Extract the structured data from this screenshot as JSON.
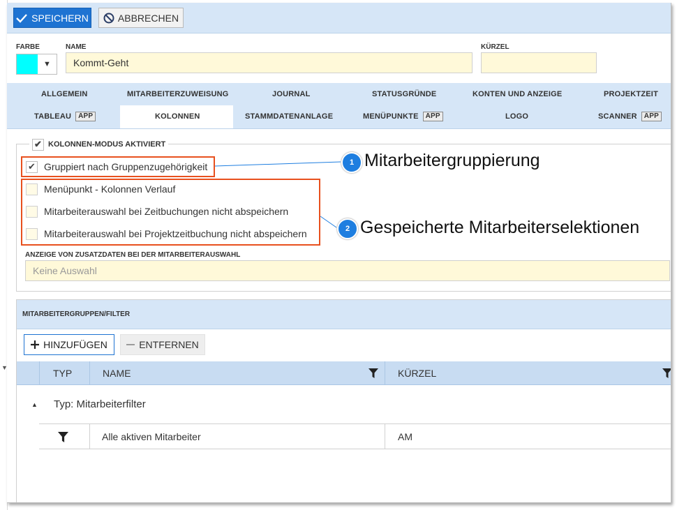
{
  "toolbar": {
    "save_label": "SPEICHERN",
    "cancel_label": "ABBRECHEN"
  },
  "form": {
    "color_label": "FARBE",
    "color_value": "#00ffff",
    "name_label": "NAME",
    "name_value": "Kommt-Geht",
    "short_label": "KÜRZEL",
    "short_value": ""
  },
  "tabs_row1": [
    "ALLGEMEIN",
    "MITARBEITERZUWEISUNG",
    "JOURNAL",
    "STATUSGRÜNDE",
    "KONTEN UND ANZEIGE",
    "PROJEKTZEIT"
  ],
  "tabs_row2": [
    {
      "label": "TABLEAU",
      "badge": "APP"
    },
    {
      "label": "KOLONNEN",
      "badge": ""
    },
    {
      "label": "STAMMDATENANLAGE",
      "badge": ""
    },
    {
      "label": "MENÜPUNKTE",
      "badge": "APP"
    },
    {
      "label": "LOGO",
      "badge": ""
    },
    {
      "label": "SCANNER",
      "badge": "APP"
    }
  ],
  "active_tab": "KOLONNEN",
  "column_mode": {
    "title": "KOLONNEN-MODUS AKTIVIERT",
    "enabled": true,
    "options": [
      {
        "label": "Gruppiert nach Gruppenzugehörigkeit",
        "checked": true
      },
      {
        "label": "Menüpunkt - Kolonnen Verlauf",
        "checked": false
      },
      {
        "label": "Mitarbeiterauswahl bei Zeitbuchungen nicht abspeichern",
        "checked": false
      },
      {
        "label": "Mitarbeiterauswahl bei Projektzeitbuchung nicht abspeichern",
        "checked": false
      }
    ],
    "extra_label": "ANZEIGE VON ZUSATZDATEN BEI DER MITARBEITERAUSWAHL",
    "extra_placeholder": "Keine Auswahl"
  },
  "callouts": [
    {
      "number": "1",
      "text": "Mitarbeitergruppierung"
    },
    {
      "number": "2",
      "text": "Gespeicherte Mitarbeiterselektionen"
    }
  ],
  "groups_panel": {
    "title": "MITARBEITERGRUPPEN/FILTER",
    "add_label": "HINZUFÜGEN",
    "remove_label": "ENTFERNEN",
    "columns": [
      "TYP",
      "NAME",
      "KÜRZEL"
    ],
    "group_label": "Typ: Mitarbeiterfilter",
    "rows": [
      {
        "name": "Alle aktiven Mitarbeiter",
        "short": "AM"
      }
    ]
  },
  "colors": {
    "accent": "#1e73d2",
    "header_bg": "#d6e6f7",
    "highlight": "#e8501e",
    "input_bg": "#fff9d9"
  }
}
